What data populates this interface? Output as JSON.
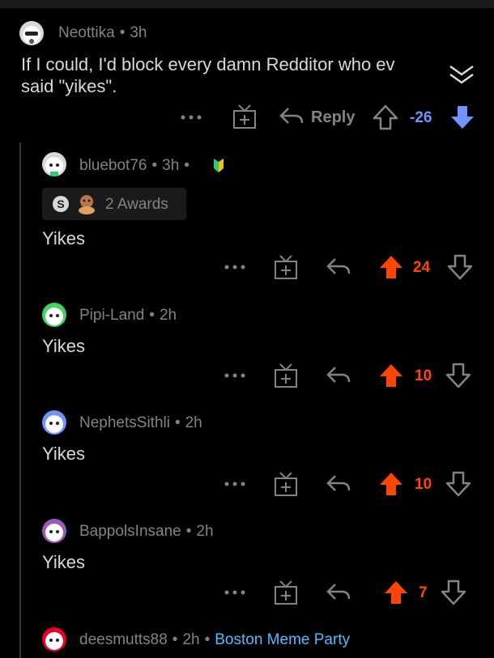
{
  "top_comment": {
    "username": "Neottika",
    "time": "3h",
    "text_line1": "If I could, I'd block every damn Redditor who ev",
    "text_line2": "said \"yikes\".",
    "reply_label": "Reply",
    "score": "-26"
  },
  "replies": [
    {
      "username": "bluebot76",
      "time": "3h",
      "awards": "2 Awards",
      "text": "Yikes",
      "score": "24"
    },
    {
      "username": "Pipi-Land",
      "time": "2h",
      "text": "Yikes",
      "score": "10"
    },
    {
      "username": "NephetsSithli",
      "time": "2h",
      "text": "Yikes",
      "score": "10"
    },
    {
      "username": "BappolsInsane",
      "time": "2h",
      "text": "Yikes",
      "score": "7"
    },
    {
      "username": "deesmutts88",
      "time": "2h",
      "flair": "Boston Meme Party"
    }
  ],
  "dot": "•",
  "colors": {
    "upvote": "#ff4500",
    "downvote": "#7193ff",
    "background": "#000000",
    "flair": "#4fbcff"
  }
}
